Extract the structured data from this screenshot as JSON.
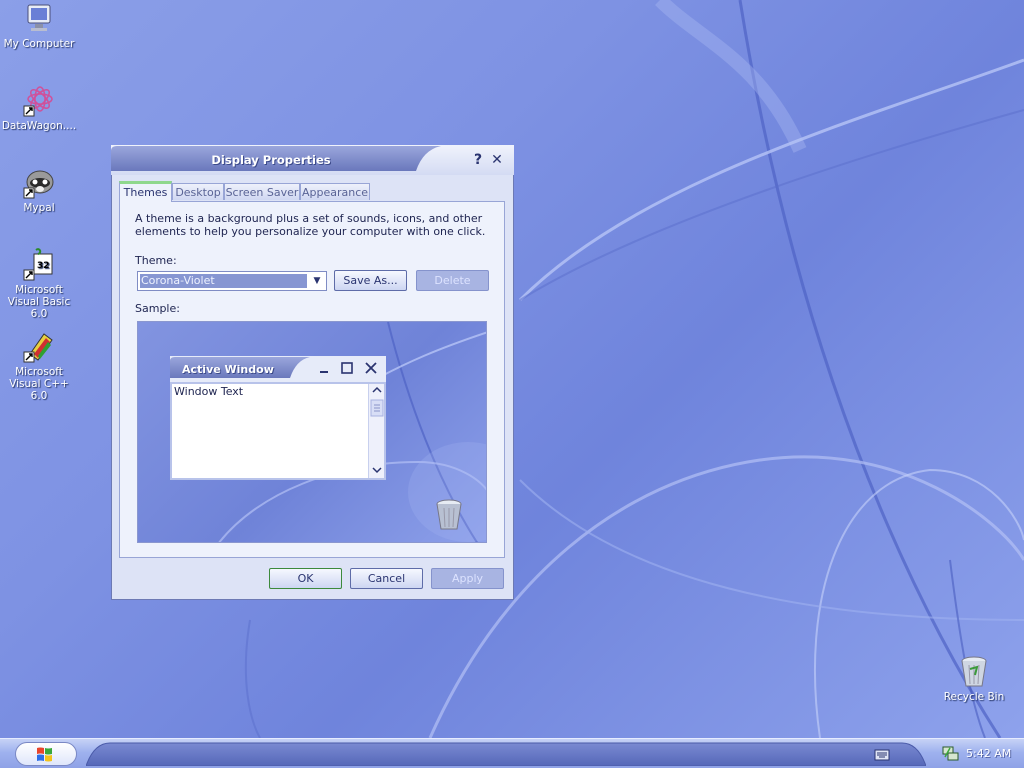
{
  "desktop": {
    "icons": [
      {
        "label": "My Computer",
        "icon": "monitor-icon"
      },
      {
        "label": "DataWagon....",
        "icon": "flower-shortcut-icon"
      },
      {
        "label": "Mypal",
        "icon": "raccoon-shortcut-icon"
      },
      {
        "label": "Microsoft Visual Basic 6.0",
        "icon": "vb6-shortcut-icon"
      },
      {
        "label": "Microsoft Visual C++ 6.0",
        "icon": "vcpp-shortcut-icon"
      },
      {
        "label": "Recycle Bin",
        "icon": "recycle-bin-icon"
      }
    ]
  },
  "dialog": {
    "title": "Display Properties",
    "help_glyph": "?",
    "close_glyph": "✕",
    "tabs": [
      "Themes",
      "Desktop",
      "Screen Saver",
      "Appearance"
    ],
    "active_tab": "Themes",
    "description": "A theme is a background plus a set of sounds, icons, and other elements to help you personalize your computer with one click.",
    "theme_label": "Theme:",
    "theme_value": "Corona-Violet",
    "save_as_label": "Save As...",
    "delete_label": "Delete",
    "sample_label": "Sample:",
    "sample": {
      "window_title": "Active Window",
      "window_text": "Window Text"
    },
    "ok_label": "OK",
    "cancel_label": "Cancel",
    "apply_label": "Apply"
  },
  "taskbar": {
    "clock": "5:42 AM"
  },
  "colors": {
    "wallpaper": "#7e92e3",
    "title_bar": "#7a88c8",
    "dialog_bg": "#dde3f6",
    "accent_green": "#8fd88d"
  }
}
